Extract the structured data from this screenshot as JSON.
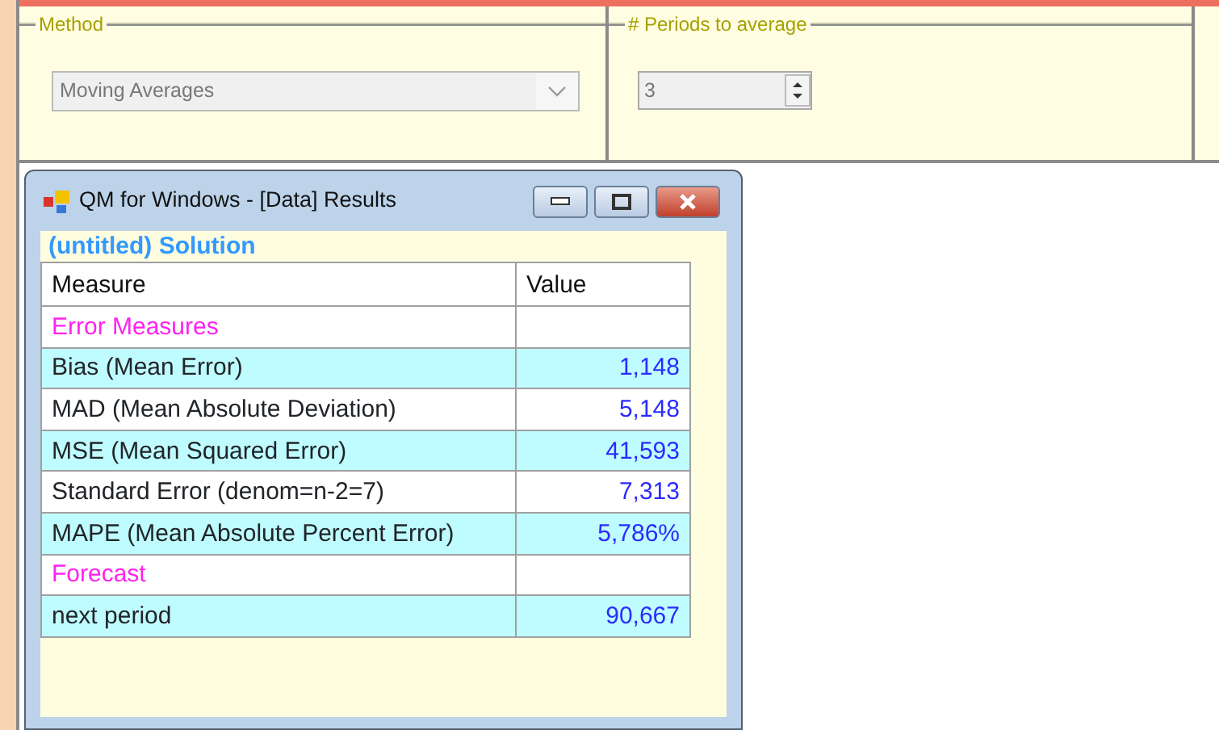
{
  "settings": {
    "method": {
      "label": "Method",
      "value": "Moving Averages"
    },
    "periods": {
      "label": "# Periods to average",
      "value": "3"
    }
  },
  "window": {
    "title": "QM for Windows - [Data] Results",
    "heading": "(untitled) Solution"
  },
  "table": {
    "columns": [
      "Measure",
      "Value"
    ],
    "rows": [
      {
        "kind": "section",
        "measure": "Error Measures"
      },
      {
        "kind": "value",
        "measure": "Bias (Mean Error)",
        "value": "1,148"
      },
      {
        "kind": "value",
        "measure": "MAD (Mean Absolute Deviation)",
        "value": "5,148"
      },
      {
        "kind": "value",
        "measure": "MSE (Mean Squared Error)",
        "value": "41,593"
      },
      {
        "kind": "value",
        "measure": "Standard Error (denom=n-2=7)",
        "value": "7,313"
      },
      {
        "kind": "value",
        "measure": "MAPE (Mean Absolute Percent Error)",
        "value": "5,786%"
      },
      {
        "kind": "section",
        "measure": "Forecast"
      },
      {
        "kind": "value",
        "measure": "next period",
        "value": "90,667"
      }
    ]
  }
}
